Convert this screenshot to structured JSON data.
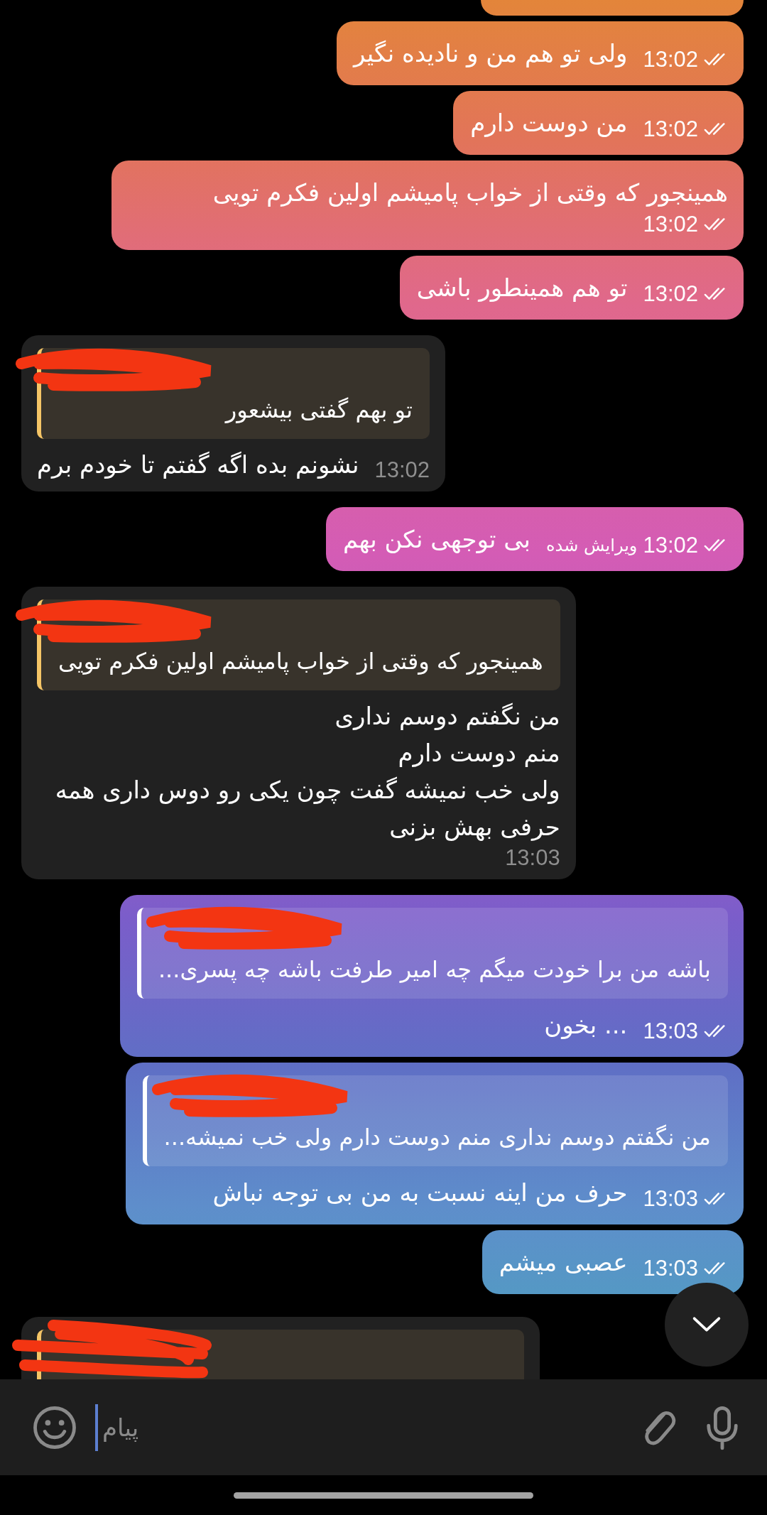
{
  "messages": [
    {
      "kind": "cut_off",
      "outgoing": true
    },
    {
      "kind": "message",
      "outgoing": true,
      "text": "ولی تو هم من و نادیده نگیر",
      "time": "13:02",
      "read": true
    },
    {
      "kind": "message",
      "outgoing": true,
      "text": "من دوست دارم",
      "time": "13:02",
      "read": true
    },
    {
      "kind": "message",
      "outgoing": true,
      "text": "همینجور که وقتی از خواب پامیشم اولین فکرم تویی",
      "time": "13:02",
      "read": true
    },
    {
      "kind": "message",
      "outgoing": true,
      "text": "تو هم همینطور باشی",
      "time": "13:02",
      "read": true
    },
    {
      "kind": "message",
      "outgoing": false,
      "reply": {
        "text": "تو بهم گفتی بیشعور"
      },
      "text": "نشونم بده اگه گفتم تا خودم برم",
      "time": "13:02"
    },
    {
      "kind": "message",
      "outgoing": true,
      "text": "بی توجهی نکن بهم",
      "time": "13:02",
      "edited": "ویرایش شده",
      "read": true
    },
    {
      "kind": "message",
      "outgoing": false,
      "reply": {
        "text": "همینجور که وقتی از خواب پامیشم اولین فکرم تویی"
      },
      "text": "من نگفتم دوسم نداری\nمنم دوست دارم\nولی خب نمیشه گفت چون یکی رو دوس داری همه\nحرفی بهش بزنی",
      "time": "13:03"
    },
    {
      "kind": "message",
      "outgoing": true,
      "reply": {
        "text": "باشه من برا خودت میگم چه امیر طرفت باشه چه پسری..."
      },
      "text": "... بخون",
      "time": "13:03",
      "read": true
    },
    {
      "kind": "message",
      "outgoing": true,
      "reply": {
        "text": "من نگفتم دوسم نداری منم دوست دارم ولی خب نمیشه..."
      },
      "text": "حرف من اینه نسبت به من بی توجه نباش",
      "time": "13:03",
      "read": true
    },
    {
      "kind": "message",
      "outgoing": true,
      "text": "عصبی میشم",
      "time": "13:03",
      "read": true
    },
    {
      "kind": "cut_off",
      "outgoing": false
    }
  ],
  "composer": {
    "placeholder": "پیام"
  }
}
